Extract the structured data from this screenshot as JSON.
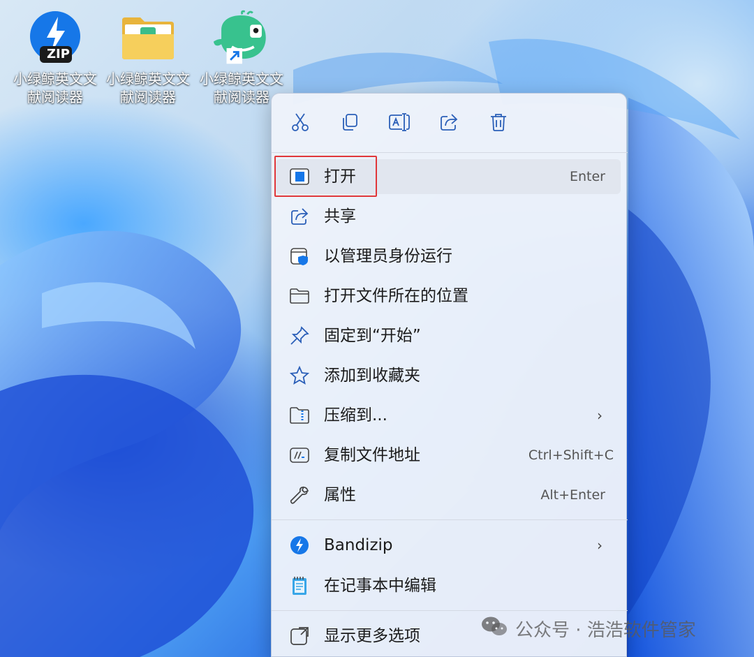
{
  "desktop": {
    "icons": [
      {
        "label": "小绿鲸英文文献阅读器",
        "badge": "ZIP",
        "kind": "zip"
      },
      {
        "label": "小绿鲸英文文献阅读器",
        "kind": "folder"
      },
      {
        "label": "小绿鲸英文文献阅读器",
        "kind": "shortcut"
      }
    ]
  },
  "context_menu": {
    "toolbar": [
      {
        "name": "cut",
        "icon": "scissors-icon"
      },
      {
        "name": "copy",
        "icon": "copy-icon"
      },
      {
        "name": "rename",
        "icon": "rename-icon"
      },
      {
        "name": "share",
        "icon": "share-icon"
      },
      {
        "name": "delete",
        "icon": "trash-icon"
      }
    ],
    "items": [
      {
        "label": "打开",
        "shortcut": "Enter",
        "icon": "open-window-icon",
        "highlighted": true
      },
      {
        "label": "共享",
        "shortcut": "",
        "icon": "share-icon"
      },
      {
        "label": "以管理员身份运行",
        "shortcut": "",
        "icon": "admin-shield-icon"
      },
      {
        "label": "打开文件所在的位置",
        "shortcut": "",
        "icon": "folder-icon"
      },
      {
        "label": "固定到“开始”",
        "shortcut": "",
        "icon": "pin-icon"
      },
      {
        "label": "添加到收藏夹",
        "shortcut": "",
        "icon": "star-icon"
      },
      {
        "label": "压缩到...",
        "shortcut": "",
        "icon": "zip-folder-icon",
        "submenu": true
      },
      {
        "label": "复制文件地址",
        "shortcut": "Ctrl+Shift+C",
        "icon": "copy-path-icon"
      },
      {
        "label": "属性",
        "shortcut": "Alt+Enter",
        "icon": "wrench-icon"
      },
      {
        "label": "Bandizip",
        "shortcut": "",
        "icon": "bandizip-icon",
        "submenu": true
      },
      {
        "label": "在记事本中编辑",
        "shortcut": "",
        "icon": "notepad-icon"
      },
      {
        "label": "显示更多选项",
        "shortcut": "",
        "icon": "more-options-icon"
      }
    ],
    "submenu_glyph": "›"
  },
  "watermark": {
    "text": "公众号 · 浩浩软件管家"
  },
  "colors": {
    "accent": "#0067c0",
    "highlight_box": "#e0373a"
  }
}
